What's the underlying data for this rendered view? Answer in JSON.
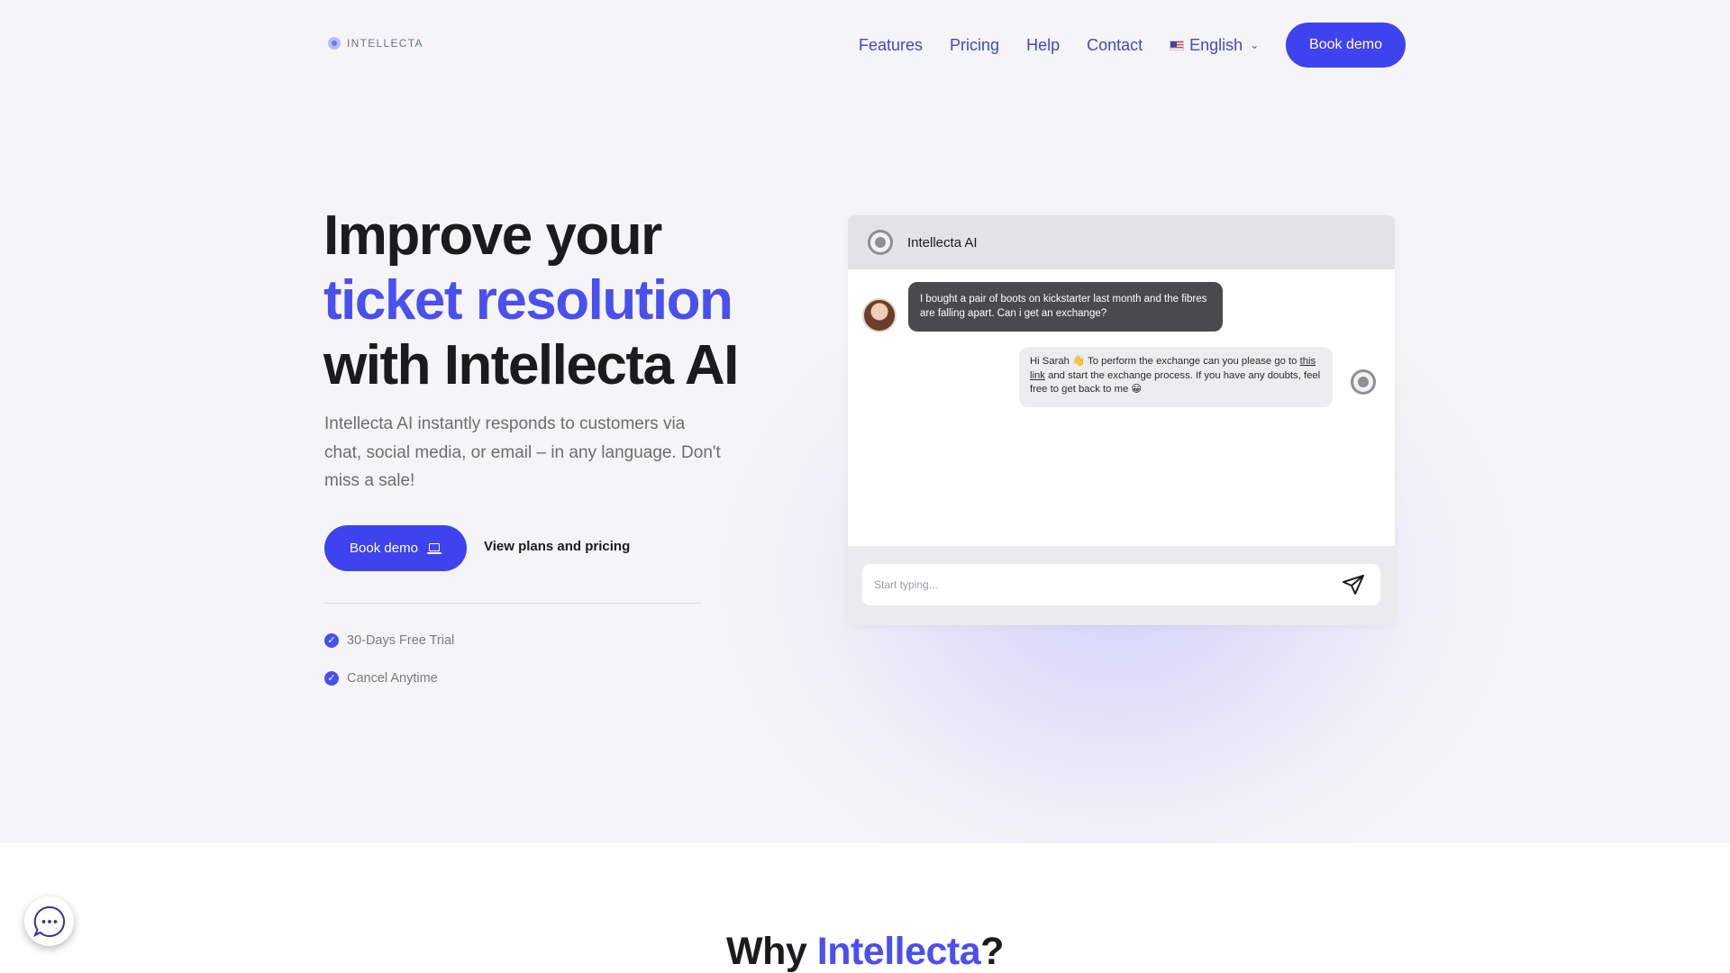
{
  "brand": {
    "name": "INTELLECTA"
  },
  "nav": {
    "links": [
      "Features",
      "Pricing",
      "Help",
      "Contact"
    ],
    "language": "English",
    "cta": "Book demo"
  },
  "hero": {
    "headline_line1": "Improve your",
    "headline_line2": "ticket resolution",
    "headline_line3": "with Intellecta AI",
    "subtext": "Intellecta AI instantly responds to customers via chat, social media, or email – in any language. Don't miss a sale!",
    "primary_cta": "Book demo",
    "secondary_cta": "View plans and pricing",
    "perks": [
      "30-Days Free Trial",
      "Cancel Anytime"
    ],
    "accent_color": "#4a4ff0"
  },
  "chat_widget": {
    "title": "Intellecta AI",
    "user_message": "I bought a pair of boots on kickstarter last month and the fibres are falling apart. Can i get an exchange?",
    "bot_message": {
      "part1": "Hi Sarah 👋 To perform the exchange can you please go to ",
      "link": "this link",
      "part2": " and start the exchange process. If you have any doubts, feel free to get back to me 😀"
    },
    "input_placeholder": "Start typing..."
  },
  "section_why": {
    "prefix": "Why ",
    "accent": "Intellecta",
    "suffix": "?"
  }
}
